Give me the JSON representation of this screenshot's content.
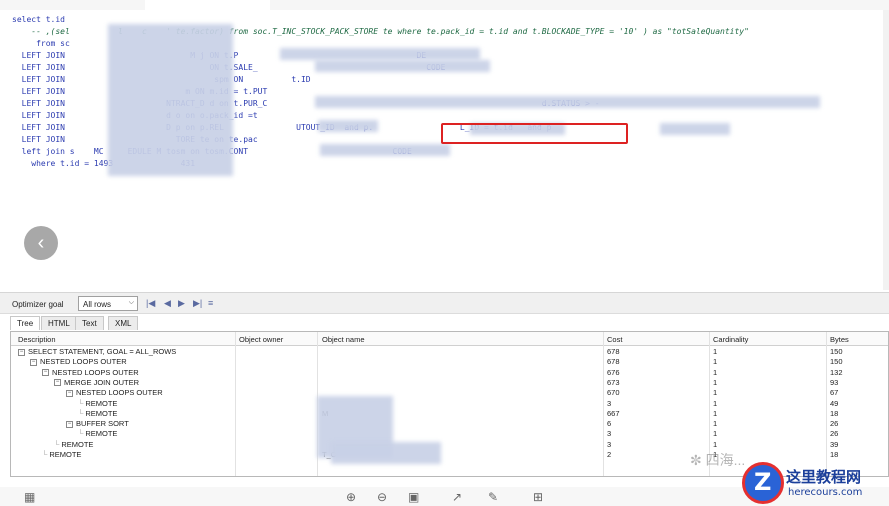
{
  "editor": {
    "lines": [
      "select t.id",
      "    -- ,(sel          l    c    ' te.factor) from soc.T_INC_STOCK_PACK_STORE te where te.pack_id = t.id and t.BLOCKADE_TYPE = '10' ) as \"totSaleQuantity\"",
      "     from sc",
      "  LEFT JOIN                          M j ON t.P                                     DE",
      "  LEFT JOIN                              ON t.SALE_                                   CODE",
      "  LEFT JOIN                               spm ON          t.ID",
      "  LEFT JOIN                         m ON m.id = t.PUT",
      "  LEFT JOIN                     NTRACT_D d on t.PUR_C                                                         d.STATUS > -",
      "  LEFT JOIN                     d o on o.pack_id =t",
      "  LEFT JOIN                     D p on p.REL               UTOUT_ID  and p.                  L_ID = t.id   and p",
      "  LEFT JOIN                       TORE te on te.pac",
      "  left join s    MC     EDULE M tosm on tosm.CONT                              CODE",
      "    where t.id = 1493              431"
    ]
  },
  "toolbar": {
    "optimizer_label": "Optimizer goal",
    "rows_select_value": "All rows"
  },
  "tabs": [
    "Tree",
    "HTML",
    "Text",
    "XML"
  ],
  "grid": {
    "columns": [
      "Description",
      "Object owner",
      "Object name",
      "Cost",
      "Cardinality",
      "Bytes"
    ],
    "rows": [
      {
        "description": "SELECT STATEMENT, GOAL = ALL_ROWS",
        "level": 0,
        "toggle": "−",
        "owner": "",
        "name": "",
        "cost": "678",
        "cardinality": "1",
        "bytes": "150"
      },
      {
        "description": "NESTED LOOPS OUTER",
        "level": 1,
        "toggle": "−",
        "owner": "",
        "name": "",
        "cost": "678",
        "cardinality": "1",
        "bytes": "150"
      },
      {
        "description": "NESTED LOOPS OUTER",
        "level": 2,
        "toggle": "−",
        "owner": "",
        "name": "",
        "cost": "676",
        "cardinality": "1",
        "bytes": "132"
      },
      {
        "description": "MERGE JOIN OUTER",
        "level": 3,
        "toggle": "−",
        "owner": "",
        "name": "",
        "cost": "673",
        "cardinality": "1",
        "bytes": "93"
      },
      {
        "description": "NESTED LOOPS OUTER",
        "level": 4,
        "toggle": "−",
        "owner": "",
        "name": "",
        "cost": "670",
        "cardinality": "1",
        "bytes": "67"
      },
      {
        "description": "REMOTE",
        "level": 5,
        "toggle": "",
        "owner": "",
        "name": "",
        "cost": "3",
        "cardinality": "1",
        "bytes": "49"
      },
      {
        "description": "REMOTE",
        "level": 5,
        "toggle": "",
        "owner": "",
        "name": "M",
        "cost": "667",
        "cardinality": "1",
        "bytes": "18"
      },
      {
        "description": "BUFFER SORT",
        "level": 4,
        "toggle": "−",
        "owner": "",
        "name": "",
        "cost": "6",
        "cardinality": "1",
        "bytes": "26"
      },
      {
        "description": "REMOTE",
        "level": 5,
        "toggle": "",
        "owner": "",
        "name": "",
        "cost": "3",
        "cardinality": "1",
        "bytes": "26"
      },
      {
        "description": "REMOTE",
        "level": 3,
        "toggle": "",
        "owner": "",
        "name": "",
        "cost": "3",
        "cardinality": "1",
        "bytes": "39"
      },
      {
        "description": "REMOTE",
        "level": 2,
        "toggle": "",
        "owner": "",
        "name": "T_C",
        "cost": "2",
        "cardinality": "1",
        "bytes": "18"
      }
    ]
  },
  "watermark": {
    "wechat_text": "四海...",
    "site_cn": "这里教程网",
    "site_url": "herecours.com"
  }
}
